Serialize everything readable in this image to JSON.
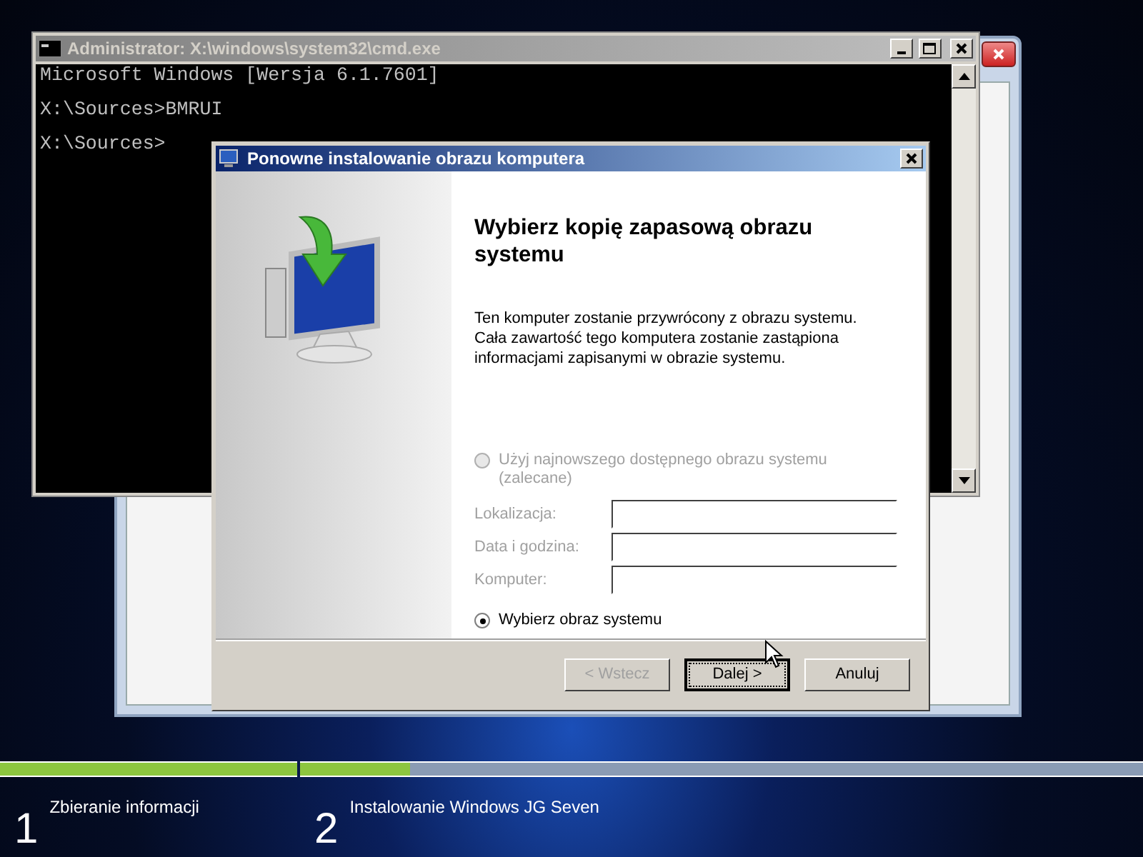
{
  "cmd_window": {
    "title": "Administrator: X:\\windows\\system32\\cmd.exe",
    "lines": [
      "Microsoft Windows [Wersja 6.1.7601]",
      "X:\\Sources>BMRUI",
      "X:\\Sources>"
    ]
  },
  "dialog": {
    "title": "Ponowne instalowanie obrazu komputera",
    "heading": "Wybierz kopię zapasową obrazu systemu",
    "description": "Ten komputer zostanie przywrócony z obrazu systemu. Cała zawartość tego komputera zostanie zastąpiona informacjami zapisanymi w obrazie systemu.",
    "options": [
      {
        "label": "Użyj najnowszego dostępnego obrazu systemu (zalecane)",
        "selected": false,
        "disabled": true
      },
      {
        "label": "Wybierz obraz systemu",
        "selected": true,
        "disabled": false
      }
    ],
    "fields": [
      {
        "label": "Lokalizacja:",
        "disabled": true
      },
      {
        "label": "Data i godzina:",
        "disabled": true
      },
      {
        "label": "Komputer:",
        "disabled": true
      }
    ],
    "buttons": [
      {
        "label": "< Wstecz",
        "disabled": true,
        "focused": false
      },
      {
        "label": "Dalej >",
        "disabled": false,
        "focused": true
      },
      {
        "label": "Anuluj",
        "disabled": false,
        "focused": false
      }
    ]
  },
  "setup_progress": {
    "steps": [
      {
        "number": "1",
        "label": "Zbieranie informacji",
        "level": 1
      },
      {
        "number": "2",
        "label": "Instalowanie Windows JG Seven",
        "level": 0.13
      }
    ]
  }
}
